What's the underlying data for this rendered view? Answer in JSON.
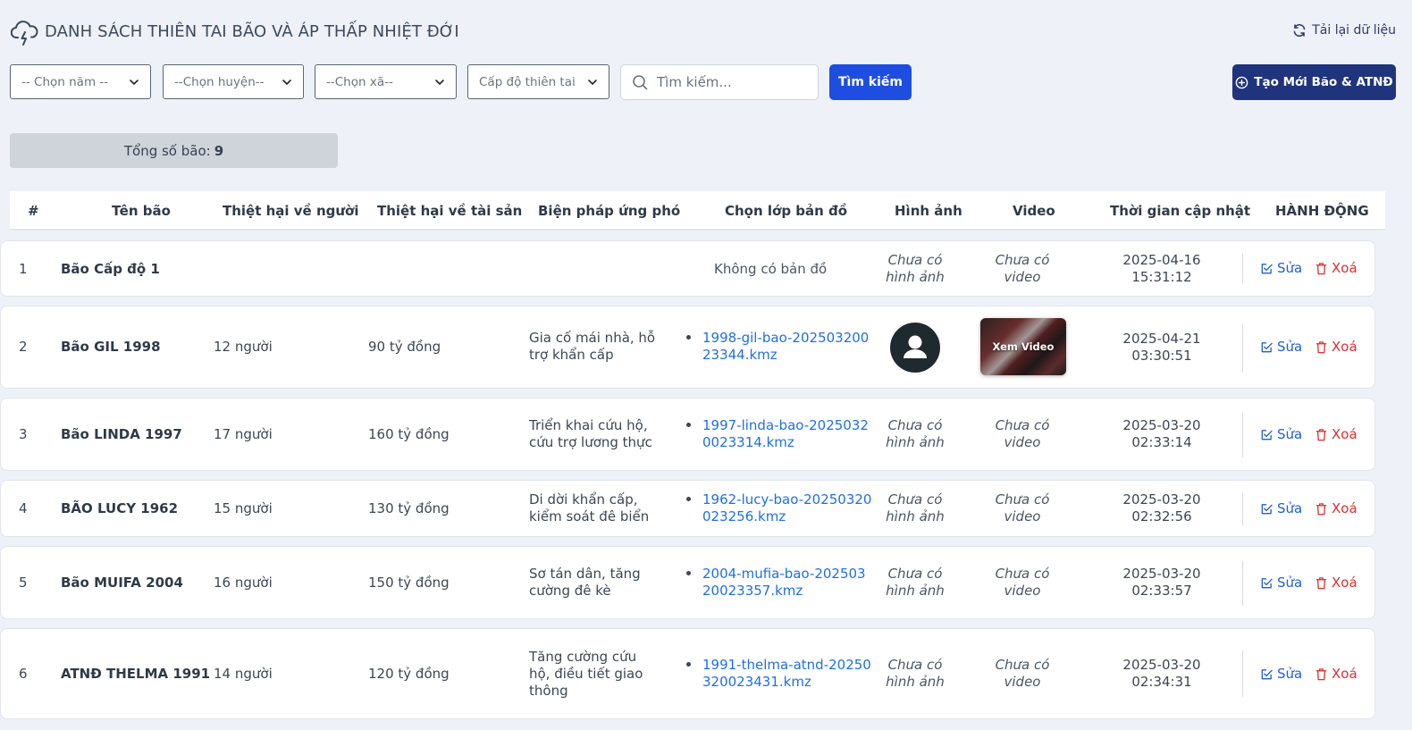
{
  "header": {
    "title": "DANH SÁCH THIÊN TAI BÃO VÀ ÁP THẤP NHIỆT ĐỚI",
    "reload_label": "Tải lại dữ liệu"
  },
  "filters": {
    "year": "-- Chọn năm --",
    "district": "--Chọn huyện--",
    "commune": "--Chọn xã--",
    "level": "Cấp độ thiên tai",
    "search_placeholder": "Tìm kiếm...",
    "search_button": "Tìm kiếm",
    "create_button": "Tạo Mới Bão & ATNĐ"
  },
  "summary": {
    "label": "Tổng số bão:",
    "count": "9"
  },
  "table": {
    "headers": {
      "idx": "#",
      "name": "Tên bão",
      "people": "Thiệt hại về người",
      "assets": "Thiệt hại về tài sản",
      "measures": "Biện pháp ứng phó",
      "map": "Chọn lớp bản đồ",
      "image": "Hình ảnh",
      "video": "Video",
      "updated": "Thời gian cập nhật",
      "actions": "HÀNH ĐỘNG"
    },
    "no_map": "Không có bản đồ",
    "no_image": "Chưa có hình ảnh",
    "no_video": "Chưa có video",
    "watch_video": "Xem Video",
    "edit_label": "Sửa",
    "delete_label": "Xoá",
    "rows": [
      {
        "idx": "1",
        "name": "Bão Cấp độ 1",
        "people": "",
        "assets": "",
        "measures": "",
        "map": "",
        "date": "2025-04-16",
        "time": "15:31:12"
      },
      {
        "idx": "2",
        "name": "Bão GIL 1998",
        "people": "12 người",
        "assets": "90 tỷ đồng",
        "measures": "Gia cố mái nhà, hỗ trợ khẩn cấp",
        "map": "1998-gil-bao-20250320023344.kmz",
        "date": "2025-04-21",
        "time": "03:30:51"
      },
      {
        "idx": "3",
        "name": "Bão LINDA 1997",
        "people": "17 người",
        "assets": "160 tỷ đồng",
        "measures": "Triển khai cứu hộ, cứu trợ lương thực",
        "map": "1997-linda-bao-20250320023314.kmz",
        "date": "2025-03-20",
        "time": "02:33:14"
      },
      {
        "idx": "4",
        "name": "BÃO LUCY 1962",
        "people": "15 người",
        "assets": "130 tỷ đồng",
        "measures": "Di dời khẩn cấp, kiểm soát đê biển",
        "map": "1962-lucy-bao-20250320023256.kmz",
        "date": "2025-03-20",
        "time": "02:32:56"
      },
      {
        "idx": "5",
        "name": "Bão MUIFA 2004",
        "people": "16 người",
        "assets": "150 tỷ đồng",
        "measures": "Sơ tán dân, tăng cường đê kè",
        "map": "2004-mufia-bao-20250320023357.kmz",
        "date": "2025-03-20",
        "time": "02:33:57"
      },
      {
        "idx": "6",
        "name": "ATNĐ THELMA 1991",
        "people": "14 người",
        "assets": "120 tỷ đồng",
        "measures": "Tăng cường cứu hộ, điều tiết giao thông",
        "map": "1991-thelma-atnd-20250320023431.kmz",
        "date": "2025-03-20",
        "time": "02:34:31"
      }
    ]
  }
}
